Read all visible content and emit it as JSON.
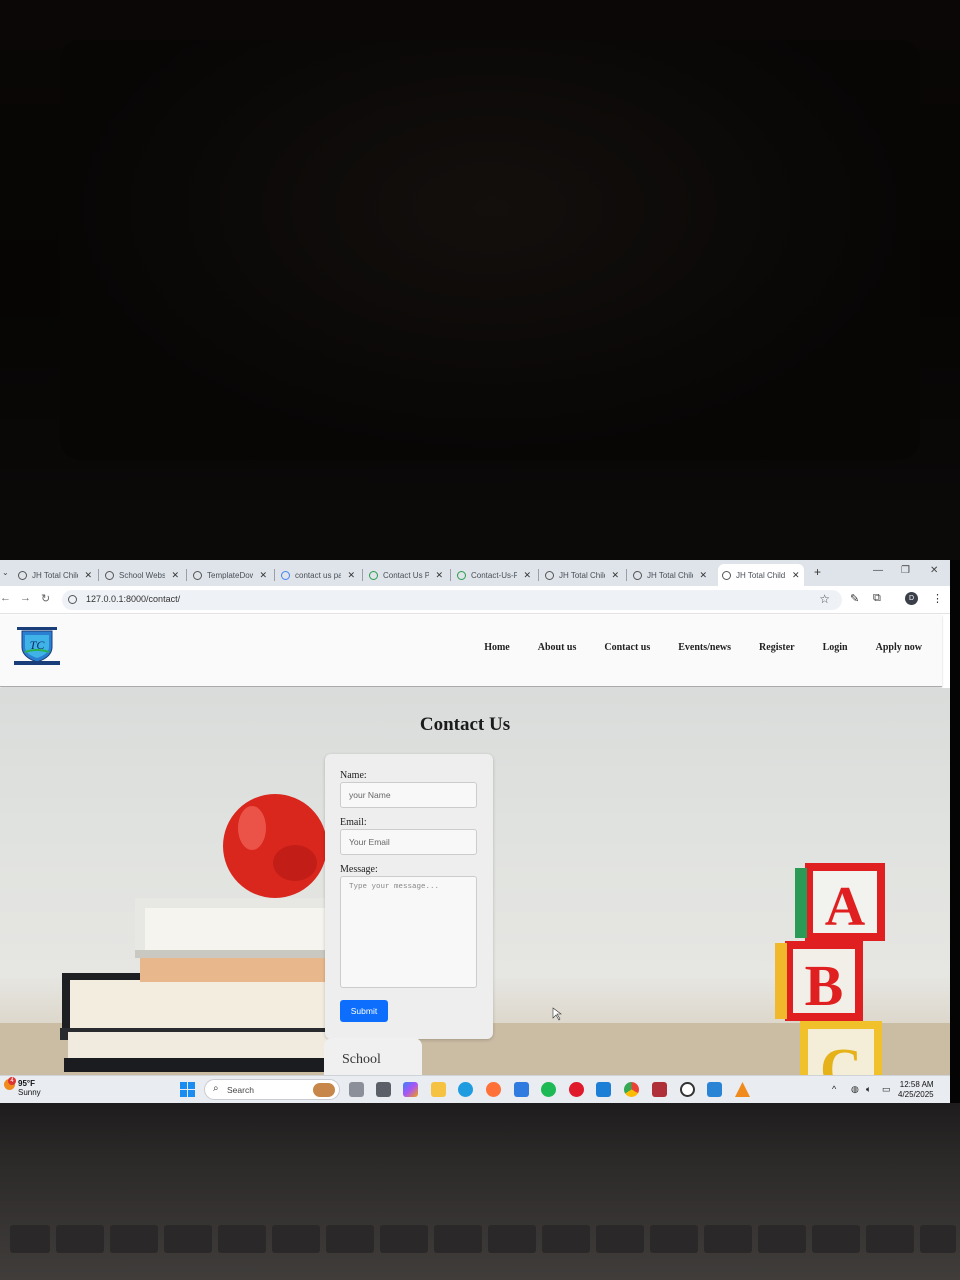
{
  "browser": {
    "tabs": [
      {
        "label": "JH Total Child",
        "icon": "globe-icon",
        "active": false
      },
      {
        "label": "School Website",
        "icon": "github-icon",
        "active": false
      },
      {
        "label": "TemplateDown",
        "icon": "globe-icon",
        "active": false
      },
      {
        "label": "contact us pa",
        "icon": "google-icon",
        "active": false
      },
      {
        "label": "Contact Us Pa",
        "icon": "deepseek-icon",
        "active": false
      },
      {
        "label": "Contact-Us-P",
        "icon": "deepseek-icon",
        "active": false
      },
      {
        "label": "JH Total Child",
        "icon": "globe-icon",
        "active": false
      },
      {
        "label": "JH Total Child",
        "icon": "globe-icon",
        "active": false
      },
      {
        "label": "JH Total Child",
        "icon": "globe-icon",
        "active": true
      }
    ],
    "new_tab_label": "+",
    "url": "127.0.0.1:8000/contact/",
    "profile_initial": "D"
  },
  "site": {
    "nav": [
      "Home",
      "About us",
      "Contact us",
      "Events/news",
      "Register",
      "Login",
      "Apply now"
    ],
    "page_title": "Contact Us",
    "form": {
      "name_label": "Name:",
      "name_placeholder": "your Name",
      "email_label": "Email:",
      "email_placeholder": "Your Email",
      "message_label": "Message:",
      "message_placeholder": "Type your message...",
      "submit_label": "Submit"
    },
    "school_card_label": "School",
    "blocks": [
      "A",
      "B",
      "C"
    ]
  },
  "taskbar": {
    "weather_temp": "95°F",
    "weather_desc": "Sunny",
    "weather_badge": "4",
    "search_label": "Search",
    "time": "12:58 AM",
    "date": "4/25/2025"
  },
  "colors": {
    "accent": "#0d6efd",
    "apple_red": "#d9271e",
    "block_red": "#e02020"
  }
}
